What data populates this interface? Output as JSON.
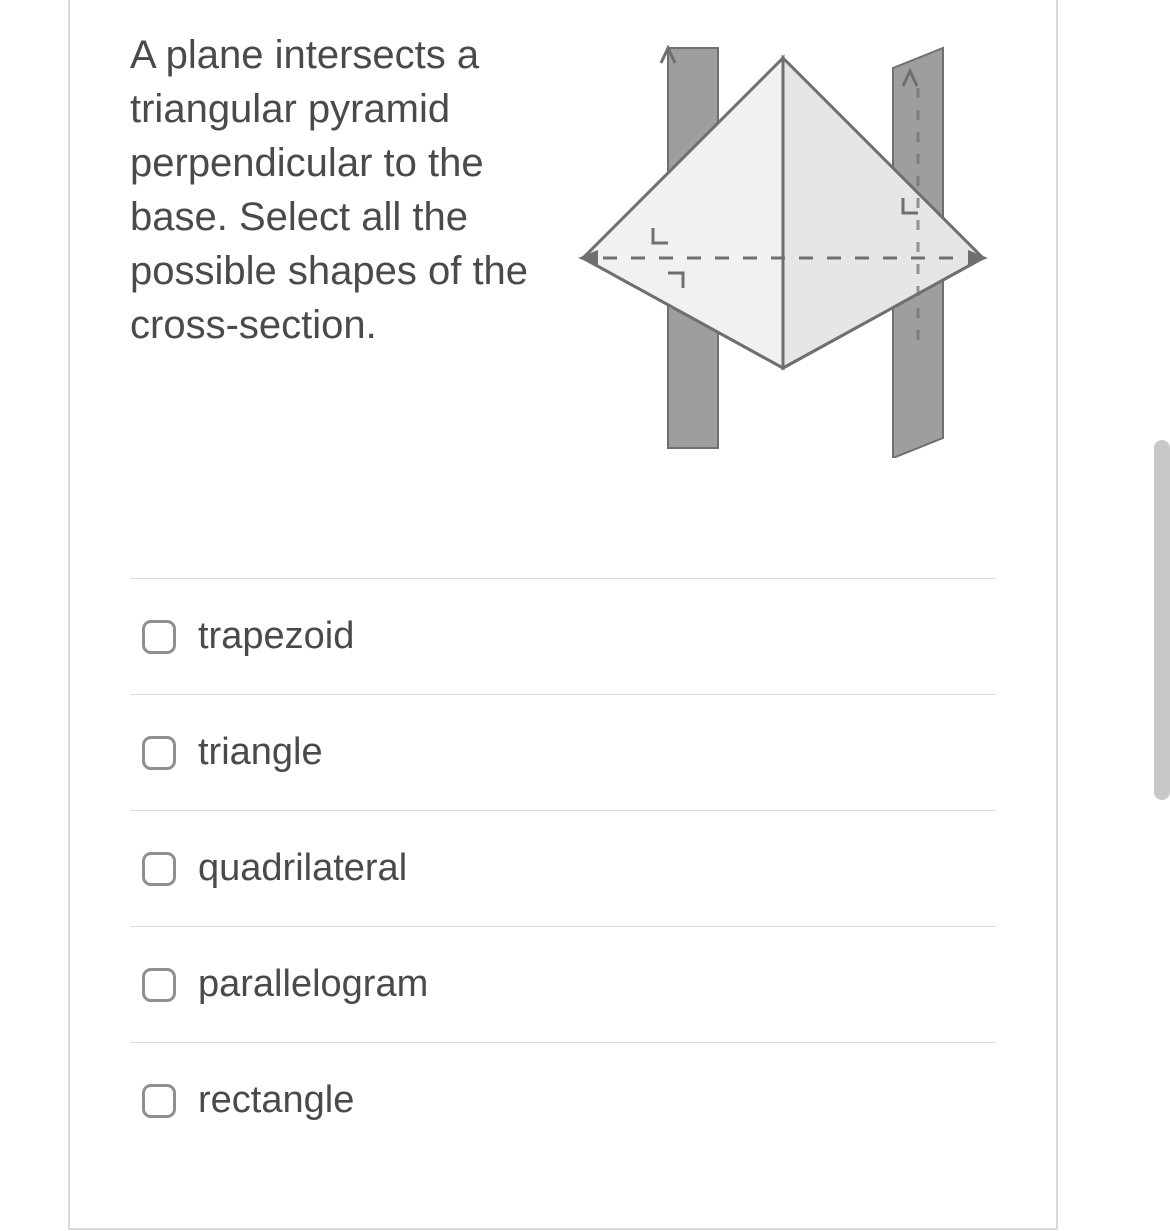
{
  "question": {
    "text": "A plane intersects a triangular pyramid perpendicular to the base. Select all the possible shapes of the cross-section."
  },
  "options": [
    {
      "label": "trapezoid",
      "checked": false
    },
    {
      "label": "triangle",
      "checked": false
    },
    {
      "label": "quadrilateral",
      "checked": false
    },
    {
      "label": "parallelogram",
      "checked": false
    },
    {
      "label": "rectangle",
      "checked": false
    }
  ]
}
